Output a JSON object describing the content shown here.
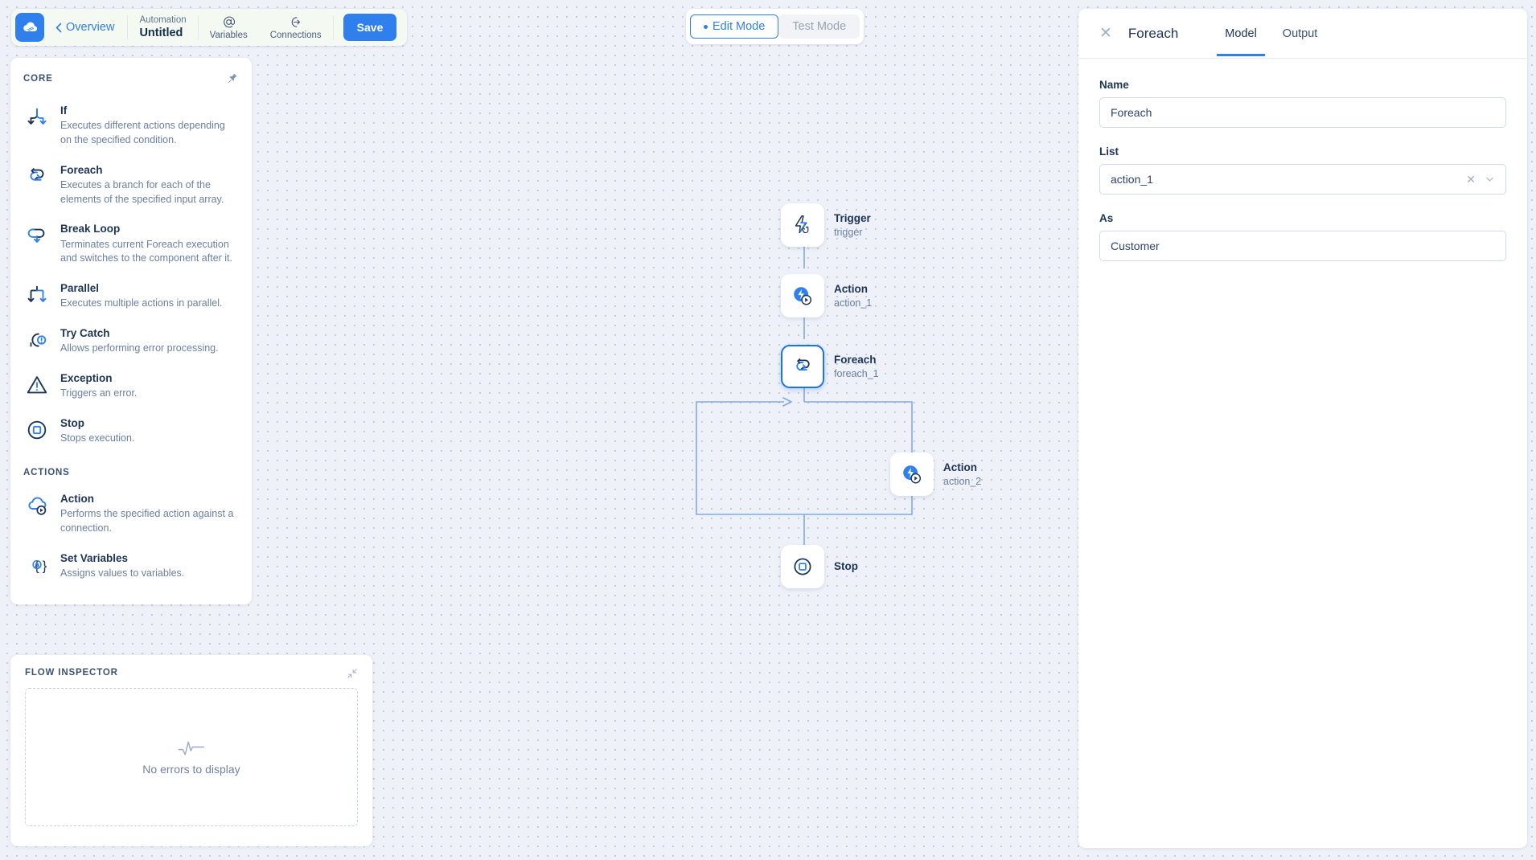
{
  "topbar": {
    "logo_icon": "cloud-logo-icon",
    "back_icon": "chevron-left-icon",
    "overview_label": "Overview",
    "automation_label": "Automation",
    "automation_name": "Untitled",
    "variables_icon": "at-sign-icon",
    "variables_label": "Variables",
    "connections_icon": "connection-arrow-icon",
    "connections_label": "Connections",
    "save_label": "Save"
  },
  "mode_toggle": {
    "edit_label": "Edit Mode",
    "test_label": "Test Mode",
    "active": "Edit Mode",
    "accent": "#2f80ed"
  },
  "palette": {
    "core_title": "CORE",
    "pin_icon": "pin-icon",
    "actions_title": "ACTIONS",
    "core_items": [
      {
        "icon": "if-branch-icon",
        "name": "If",
        "desc": "Executes different actions depending on the specified condition."
      },
      {
        "icon": "foreach-loop-icon",
        "name": "Foreach",
        "desc": "Executes a branch for each of the elements of the specified input array."
      },
      {
        "icon": "break-loop-icon",
        "name": "Break Loop",
        "desc": "Terminates current Foreach execution and switches to the component after it."
      },
      {
        "icon": "parallel-icon",
        "name": "Parallel",
        "desc": "Executes multiple actions in parallel."
      },
      {
        "icon": "try-catch-icon",
        "name": "Try Catch",
        "desc": "Allows performing error processing."
      },
      {
        "icon": "exception-warning-icon",
        "name": "Exception",
        "desc": "Triggers an error."
      },
      {
        "icon": "stop-icon",
        "name": "Stop",
        "desc": "Stops execution."
      }
    ],
    "action_items": [
      {
        "icon": "cloud-action-icon",
        "name": "Action",
        "desc": "Performs the specified action against a connection."
      },
      {
        "icon": "set-variables-icon",
        "name": "Set Variables",
        "desc": "Assigns values to variables."
      }
    ]
  },
  "flow_inspector": {
    "title": "FLOW INSPECTOR",
    "expand_icon": "collapse-diagonal-icon",
    "empty_icon": "pulse-line-icon",
    "empty_text": "No errors to display"
  },
  "flow": {
    "nodes": [
      {
        "icon": "trigger-bolt-icon",
        "title": "Trigger",
        "sub": "trigger",
        "selected": false
      },
      {
        "icon": "action-bolt-icon",
        "title": "Action",
        "sub": "action_1",
        "selected": false
      },
      {
        "icon": "foreach-loop-icon",
        "title": "Foreach",
        "sub": "foreach_1",
        "selected": true
      },
      {
        "icon": "action-bolt-icon",
        "title": "Action",
        "sub": "action_2",
        "selected": false
      },
      {
        "icon": "stop-icon",
        "title": "Stop",
        "sub": "",
        "selected": false
      }
    ],
    "edge_color": "#7fa9e8"
  },
  "right_panel": {
    "close_icon": "close-icon",
    "title": "Foreach",
    "tabs": [
      {
        "label": "Model",
        "active": true
      },
      {
        "label": "Output",
        "active": false
      }
    ],
    "fields": [
      {
        "label": "Name",
        "value": "Foreach",
        "type": "text"
      },
      {
        "label": "List",
        "value": "action_1",
        "type": "select",
        "clear_icon": "clear-x-icon",
        "caret_icon": "chevron-down-icon"
      },
      {
        "label": "As",
        "value": "Customer",
        "type": "text"
      }
    ]
  }
}
